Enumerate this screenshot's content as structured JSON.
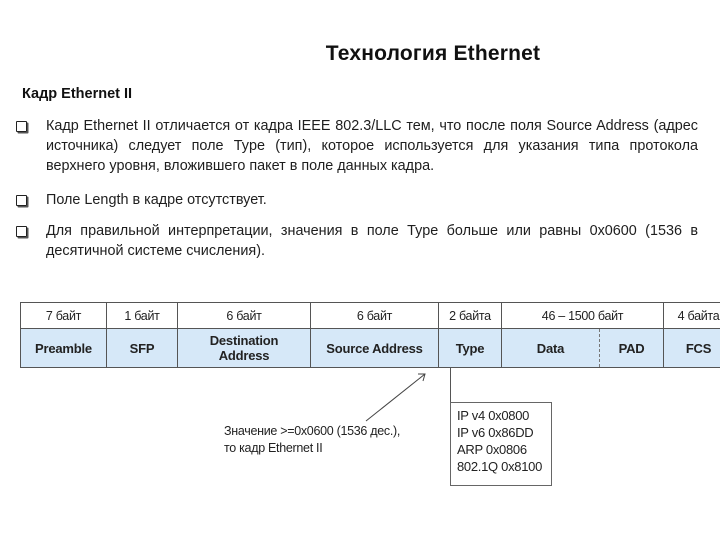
{
  "slide": {
    "title": "Технология Ethernet",
    "subtitle": "Кадр Ethernet II",
    "bullets": [
      {
        "text": "Кадр Ethernet II отличается от кадра IEEE 802.3/LLC тем, что после поля Source Address (адрес источника) следует поле Type (тип), которое используется для указания типа протокола верхнего уровня, вложившего пакет в поле данных кадра."
      },
      {
        "text": "Поле Length в кадре отсутствует."
      },
      {
        "text": "Для правильной интерпретации, значения в поле Type больше или равны 0x0600 (1536 в десятичной системе счисления)."
      }
    ],
    "bullet_icon": "checkbox-square-icon"
  },
  "frame_diagram": {
    "sizes": [
      "7 байт",
      "1 байт",
      "6 байт",
      "6 байт",
      "2 байта",
      "46 – 1500 байт",
      "4 байта"
    ],
    "fields": [
      "Preamble",
      "SFP",
      "Destination Address",
      "Source Address",
      "Type",
      "Data",
      "PAD",
      "FCS"
    ],
    "header_fill": "#d6e8f8",
    "note": {
      "line1": "Значение >=0x0600 (1536 дес.),",
      "line2": "то кадр Ethernet II"
    },
    "type_values": [
      "IP v4 0x0800",
      "IP v6 0x86DD",
      "ARP 0x0806",
      "802.1Q 0x8100"
    ]
  }
}
